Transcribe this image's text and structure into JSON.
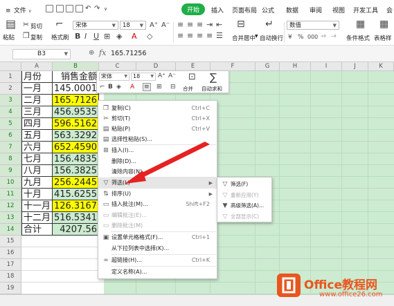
{
  "ribbon": {
    "file_label": "文件",
    "tabs": [
      {
        "label": "开始",
        "active": true
      },
      {
        "label": "插入"
      },
      {
        "label": "页面布局"
      },
      {
        "label": "公式"
      },
      {
        "label": "数据"
      },
      {
        "label": "审阅"
      },
      {
        "label": "视图"
      },
      {
        "label": "开发工具"
      },
      {
        "label": "会"
      }
    ],
    "accent_color": "#1fae47"
  },
  "toolbar": {
    "cut_label": "剪切",
    "paste_label": "粘贴",
    "copy_label": "复制",
    "format_painter_label": "格式刷",
    "font_name": "宋体",
    "font_size": "18",
    "merge_label": "合并居中",
    "wrap_label": "自动换行",
    "number_format": "数值",
    "conditional_format_label": "条件格式",
    "table_style_label": "表格样"
  },
  "formula_bar": {
    "name_box": "B3",
    "fx_label": "fx",
    "value": "165.71256"
  },
  "sheet": {
    "columns": [
      "A",
      "B",
      "C",
      "D",
      "E",
      "F",
      "G",
      "H",
      "I",
      "J",
      "K"
    ],
    "rows": [
      "1",
      "2",
      "3",
      "4",
      "5",
      "6",
      "7",
      "8",
      "9",
      "10",
      "11",
      "12",
      "13",
      "14",
      "15",
      "16",
      "17",
      "18",
      "19"
    ],
    "data": [
      {
        "a": "月份",
        "b": "销售金额",
        "highlight": false
      },
      {
        "a": "一月",
        "b": "145.0001",
        "highlight": false
      },
      {
        "a": "二月",
        "b": "165.7126",
        "highlight": true
      },
      {
        "a": "三月",
        "b": "456.9535",
        "highlight": false
      },
      {
        "a": "四月",
        "b": "596.5162",
        "highlight": true
      },
      {
        "a": "五月",
        "b": "563.3292",
        "highlight": false
      },
      {
        "a": "六月",
        "b": "652.4590",
        "highlight": true
      },
      {
        "a": "七月",
        "b": "156.4835",
        "highlight": false
      },
      {
        "a": "八月",
        "b": "156.3825",
        "highlight": false
      },
      {
        "a": "九月",
        "b": "256.2445",
        "highlight": true
      },
      {
        "a": "十月",
        "b": "415.6255",
        "highlight": false
      },
      {
        "a": "十一月",
        "b": "126.3167",
        "highlight": true
      },
      {
        "a": "十二月",
        "b": "516.5341",
        "highlight": false
      },
      {
        "a": "合计",
        "b": "4207.56",
        "highlight": false
      }
    ],
    "highlight_color": "#ffff00",
    "selection_color": "#ccebd0"
  },
  "mini_toolbar": {
    "font_name": "宋体",
    "font_size": "18",
    "merge_label": "合并",
    "autosum_label": "自动求和"
  },
  "context_menu": {
    "items": [
      {
        "icon": "copy-icon",
        "label": "复制(C)",
        "shortcut": "Ctrl+C"
      },
      {
        "icon": "cut-icon",
        "label": "剪切(T)",
        "shortcut": "Ctrl+X"
      },
      {
        "icon": "paste-icon",
        "label": "粘贴(P)",
        "shortcut": "Ctrl+V"
      },
      {
        "icon": "paste-special-icon",
        "label": "选择性粘贴(S)..."
      },
      {
        "icon": "insert-icon",
        "label": "插入(I)..."
      },
      {
        "icon": "",
        "label": "删除(D)..."
      },
      {
        "icon": "",
        "label": "清除内容(N)"
      },
      {
        "icon": "filter-icon",
        "label": "筛选(L)",
        "submenu": true
      },
      {
        "icon": "sort-icon",
        "label": "排序(U)",
        "submenu": true
      },
      {
        "icon": "comment-icon",
        "label": "插入批注(M)...",
        "shortcut": "Shift+F2"
      },
      {
        "icon": "edit-comment-icon",
        "label": "编辑批注(E)...",
        "disabled": true
      },
      {
        "icon": "delete-comment-icon",
        "label": "删除批注(M)",
        "disabled": true
      },
      {
        "icon": "format-cells-icon",
        "label": "设置单元格格式(F)...",
        "shortcut": "Ctrl+1"
      },
      {
        "icon": "",
        "label": "从下拉列表中选择(K)..."
      },
      {
        "icon": "hyperlink-icon",
        "label": "超链接(H)...",
        "shortcut": "Ctrl+K"
      },
      {
        "icon": "",
        "label": "定义名称(A)..."
      }
    ]
  },
  "filter_submenu": {
    "items": [
      {
        "icon": "filter-icon",
        "label": "筛选(F)"
      },
      {
        "icon": "reapply-icon",
        "label": "重新应用(Y)",
        "disabled": true
      },
      {
        "icon": "advanced-filter-icon",
        "label": "高级筛选(A)..."
      },
      {
        "icon": "show-all-icon",
        "label": "全部显示(C)",
        "disabled": true
      }
    ]
  },
  "watermark": {
    "brand": "Office教程网",
    "url": "www.office26.com",
    "color": "#e8561f"
  }
}
